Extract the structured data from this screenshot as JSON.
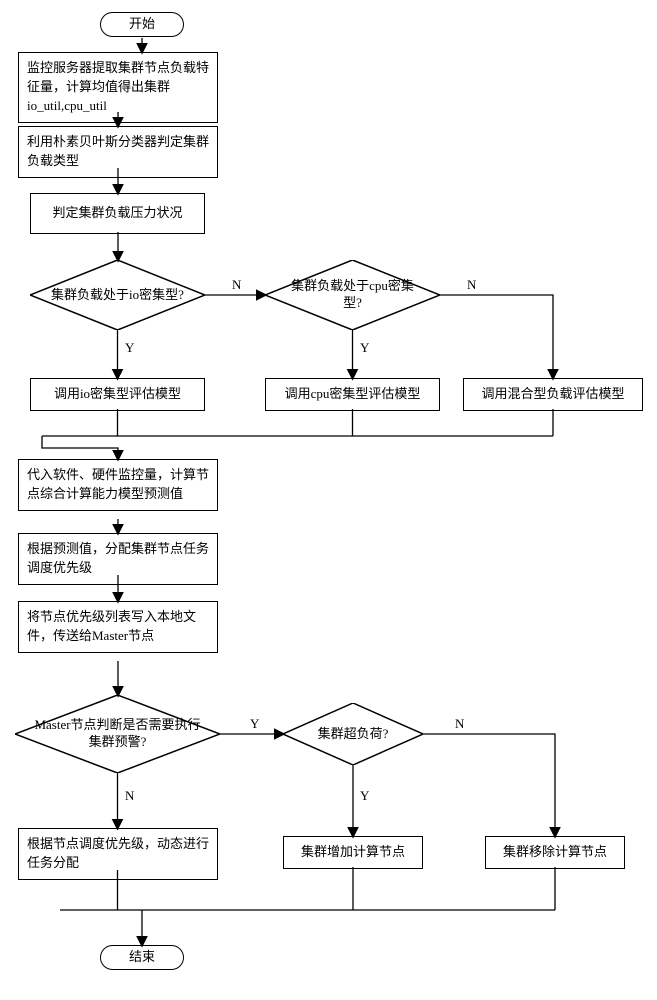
{
  "chart_data": {
    "type": "flowchart",
    "title": "",
    "nodes": [
      {
        "id": "start",
        "kind": "terminator",
        "text": "开始"
      },
      {
        "id": "p1",
        "kind": "process",
        "text": "监控服务器提取集群节点负载特征量，计算均值得出集群io_util,cpu_util"
      },
      {
        "id": "p2",
        "kind": "process",
        "text": "利用朴素贝叶斯分类器判定集群负载类型"
      },
      {
        "id": "p3",
        "kind": "process",
        "text": "判定集群负载压力状况"
      },
      {
        "id": "d1",
        "kind": "decision",
        "text": "集群负载处于io密集型?"
      },
      {
        "id": "d2",
        "kind": "decision",
        "text": "集群负载处于cpu密集型?"
      },
      {
        "id": "m_io",
        "kind": "process",
        "text": "调用io密集型评估模型"
      },
      {
        "id": "m_cpu",
        "kind": "process",
        "text": "调用cpu密集型评估模型"
      },
      {
        "id": "m_mix",
        "kind": "process",
        "text": "调用混合型负载评估模型"
      },
      {
        "id": "p4",
        "kind": "process",
        "text": "代入软件、硬件监控量，计算节点综合计算能力模型预测值"
      },
      {
        "id": "p5",
        "kind": "process",
        "text": "根据预测值，分配集群节点任务调度优先级"
      },
      {
        "id": "p6",
        "kind": "process",
        "text": "将节点优先级列表写入本地文件，传送给Master节点"
      },
      {
        "id": "d3",
        "kind": "decision",
        "text": "Master节点判断是否需要执行集群预警?"
      },
      {
        "id": "d4",
        "kind": "decision",
        "text": "集群超负荷?"
      },
      {
        "id": "p7",
        "kind": "process",
        "text": "根据节点调度优先级，动态进行任务分配"
      },
      {
        "id": "p8",
        "kind": "process",
        "text": "集群增加计算节点"
      },
      {
        "id": "p9",
        "kind": "process",
        "text": "集群移除计算节点"
      },
      {
        "id": "end",
        "kind": "terminator",
        "text": "结束"
      }
    ],
    "edges": [
      {
        "from": "start",
        "to": "p1"
      },
      {
        "from": "p1",
        "to": "p2"
      },
      {
        "from": "p2",
        "to": "p3"
      },
      {
        "from": "p3",
        "to": "d1"
      },
      {
        "from": "d1",
        "to": "m_io",
        "label": "Y"
      },
      {
        "from": "d1",
        "to": "d2",
        "label": "N"
      },
      {
        "from": "d2",
        "to": "m_cpu",
        "label": "Y"
      },
      {
        "from": "d2",
        "to": "m_mix",
        "label": "N"
      },
      {
        "from": "m_io",
        "to": "p4"
      },
      {
        "from": "m_cpu",
        "to": "p4"
      },
      {
        "from": "m_mix",
        "to": "p4"
      },
      {
        "from": "p4",
        "to": "p5"
      },
      {
        "from": "p5",
        "to": "p6"
      },
      {
        "from": "p6",
        "to": "d3"
      },
      {
        "from": "d3",
        "to": "p7",
        "label": "N"
      },
      {
        "from": "d3",
        "to": "d4",
        "label": "Y"
      },
      {
        "from": "d4",
        "to": "p8",
        "label": "Y"
      },
      {
        "from": "d4",
        "to": "p9",
        "label": "N"
      },
      {
        "from": "p7",
        "to": "end"
      },
      {
        "from": "p8",
        "to": "end"
      },
      {
        "from": "p9",
        "to": "end"
      }
    ],
    "labels": {
      "Y": "Y",
      "N": "N"
    }
  }
}
